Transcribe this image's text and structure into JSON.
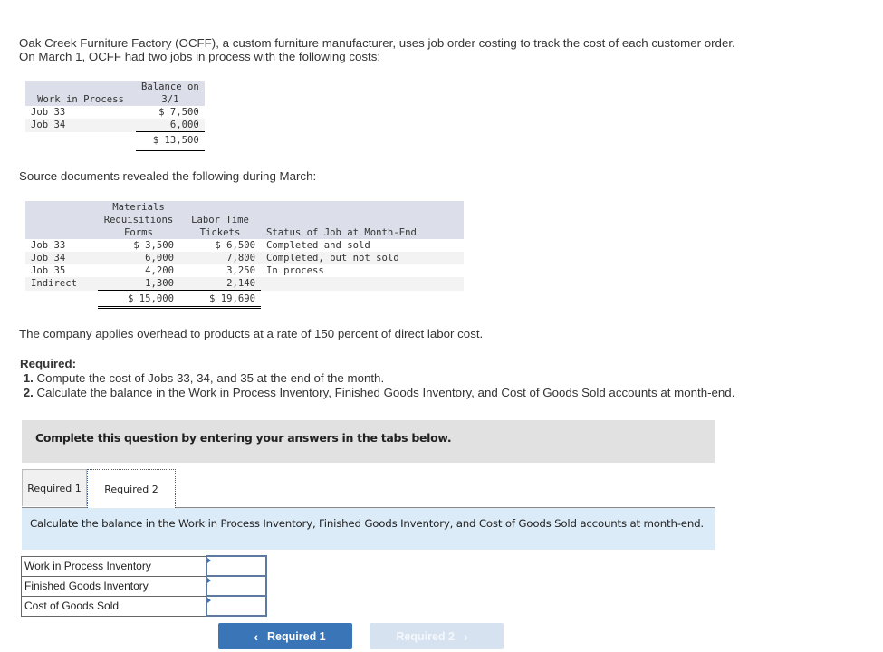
{
  "intro": {
    "line1": "Oak Creek Furniture Factory (OCFF), a custom furniture manufacturer, uses job order costing to track the cost of each customer order.",
    "line2": "On March 1, OCFF had two jobs in process with the following costs:"
  },
  "wip_table": {
    "col1_header": "Work in Process",
    "col2_header_line1": "Balance on",
    "col2_header_line2": "3/1",
    "rows": [
      {
        "job": "Job 33",
        "balance": "$ 7,500"
      },
      {
        "job": "Job 34",
        "balance": "6,000"
      }
    ],
    "total": "$ 13,500"
  },
  "source_intro": "Source documents revealed the following during March:",
  "source_table": {
    "headers": {
      "materials_l1": "Materials",
      "materials_l2": "Requisitions",
      "materials_l3": "Forms",
      "labor_l1": "Labor Time",
      "labor_l2": "Tickets",
      "status": "Status of Job at Month-End"
    },
    "rows": [
      {
        "job": "Job 33",
        "materials": "$ 3,500",
        "labor": "$ 6,500",
        "status": "Completed and sold"
      },
      {
        "job": "Job 34",
        "materials": "6,000",
        "labor": "7,800",
        "status": "Completed, but not sold"
      },
      {
        "job": "Job 35",
        "materials": "4,200",
        "labor": "3,250",
        "status": "In process"
      },
      {
        "job": "Indirect",
        "materials": "1,300",
        "labor": "2,140",
        "status": ""
      }
    ],
    "totals": {
      "materials": "$ 15,000",
      "labor": "$ 19,690"
    }
  },
  "overhead_text": "The company applies overhead to products at a rate of 150 percent of direct labor cost.",
  "required": {
    "title": "Required:",
    "items": [
      {
        "num": "1.",
        "text": " Compute the cost of Jobs 33, 34, and 35 at the end of the month."
      },
      {
        "num": "2.",
        "text": " Calculate the balance in the Work in Process Inventory, Finished Goods Inventory, and Cost of Goods Sold accounts at month-end."
      }
    ]
  },
  "instruction_box": "Complete this question by entering your answers in the tabs below.",
  "tabs": [
    {
      "label": "Required 1",
      "active": false
    },
    {
      "label": "Required 2",
      "active": true
    }
  ],
  "tab_instruction": "Calculate the balance in the Work in Process Inventory, Finished Goods Inventory, and Cost of Goods Sold accounts at month-end.",
  "answer_rows": [
    {
      "label": "Work in Process Inventory",
      "value": ""
    },
    {
      "label": "Finished Goods Inventory",
      "value": ""
    },
    {
      "label": "Cost of Goods Sold",
      "value": ""
    }
  ],
  "nav": {
    "prev_label": "Required 1",
    "next_label": "Required 2",
    "prev_icon": "‹",
    "next_icon": "›"
  }
}
